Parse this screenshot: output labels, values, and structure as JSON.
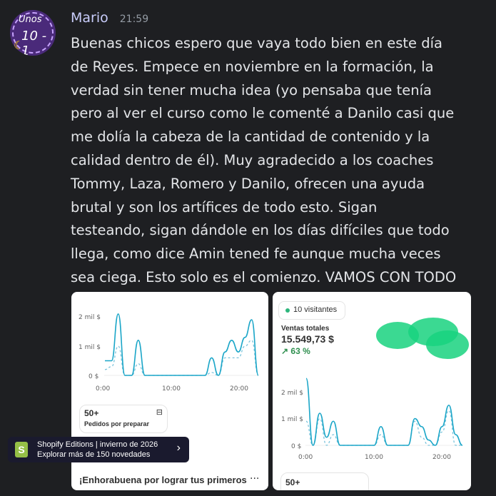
{
  "message": {
    "author": "Mario",
    "time": "21:59",
    "avatar_text_1": "Unos",
    "avatar_text_2": "10 - 1",
    "text": "Buenas chicos espero que vaya todo bien en este día\nde Reyes. Empece en noviembre en la formación, la\nverdad sin tener mucha idea (yo pensaba que tenía\npero al ver el curso como le comenté a Danilo casi que\nme dolía la cabeza de la cantidad de contenido y la\ncalidad dentro de él). Muy agradecido a los coaches\nTommy, Laza, Romero y Danilo, ofrecen una ayuda\nbrutal y son los artífices de todo esto. Sigan\ntesteando, sigan dándole en los días difíciles que todo\nllega, como dice Amin tened fe aunque mucha veces\nsea ciega. Esto solo es el comienzo. VAMOS CON TODO"
  },
  "attachment1": {
    "y_ticks": [
      "2 mil $",
      "1 mil $",
      "0 $"
    ],
    "x_ticks": [
      "0:00",
      "10:00",
      "20:00"
    ],
    "orders_count": "50+",
    "orders_label": "Pedidos por preparar",
    "banner_line1": "Shopify Editions | invierno de 2026",
    "banner_line2": "Explorar más de 150 novedades",
    "congrats": "¡Enhorabuena por lograr tus primeros",
    "more": "···"
  },
  "attachment2": {
    "visitors": "10 visitantes",
    "sales_label": "Ventas totales",
    "sales_value": "15.549,73 $",
    "growth": "↗ 63 %",
    "y_ticks": [
      "2 mil $",
      "1 mil $",
      "0 $"
    ],
    "x_ticks": [
      "0:00",
      "10:00",
      "20:00"
    ],
    "orders_count": "50+"
  },
  "chart_data": [
    {
      "type": "line",
      "ylim": [
        0,
        2000
      ],
      "series": [
        {
          "x": [
            0,
            1,
            2,
            3,
            4,
            5,
            6,
            7,
            8,
            9,
            10,
            11,
            12,
            13,
            14,
            15,
            16,
            17,
            18,
            19,
            20,
            21,
            22,
            23
          ],
          "values": [
            500,
            500,
            2100,
            0,
            0,
            1200,
            0,
            0,
            0,
            0,
            0,
            0,
            0,
            0,
            0,
            0,
            600,
            0,
            800,
            1200,
            800,
            1300,
            1900,
            0
          ]
        },
        {
          "x": [
            0,
            1,
            2,
            3,
            4,
            5,
            6,
            7,
            8,
            9,
            10,
            11,
            12,
            13,
            14,
            15,
            16,
            17,
            18,
            19,
            20,
            21,
            22,
            23
          ],
          "values": [
            200,
            300,
            1000,
            0,
            0,
            400,
            0,
            0,
            0,
            0,
            0,
            0,
            0,
            0,
            0,
            0,
            100,
            0,
            600,
            600,
            600,
            1000,
            1200,
            0
          ]
        }
      ]
    },
    {
      "type": "line",
      "ylim": [
        0,
        2000
      ],
      "series": [
        {
          "x": [
            0,
            1,
            2,
            3,
            4,
            5,
            6,
            7,
            8,
            9,
            10,
            11,
            12,
            13,
            14,
            15,
            16,
            17,
            18,
            19,
            20,
            21,
            22,
            23
          ],
          "values": [
            2500,
            0,
            1200,
            300,
            900,
            0,
            0,
            0,
            0,
            0,
            0,
            700,
            0,
            0,
            0,
            0,
            1000,
            700,
            200,
            0,
            700,
            1500,
            400,
            0
          ]
        },
        {
          "x": [
            0,
            1,
            2,
            3,
            4,
            5,
            6,
            7,
            8,
            9,
            10,
            11,
            12,
            13,
            14,
            15,
            16,
            17,
            18,
            19,
            20,
            21,
            22,
            23
          ],
          "values": [
            900,
            0,
            1000,
            0,
            400,
            0,
            0,
            0,
            0,
            0,
            0,
            400,
            0,
            0,
            0,
            0,
            900,
            300,
            0,
            0,
            500,
            1300,
            0,
            0
          ]
        }
      ]
    }
  ],
  "colors": {
    "line": "#1ba6c8",
    "dashed": "#7cc4dc",
    "growth": "#2e8f4e"
  }
}
